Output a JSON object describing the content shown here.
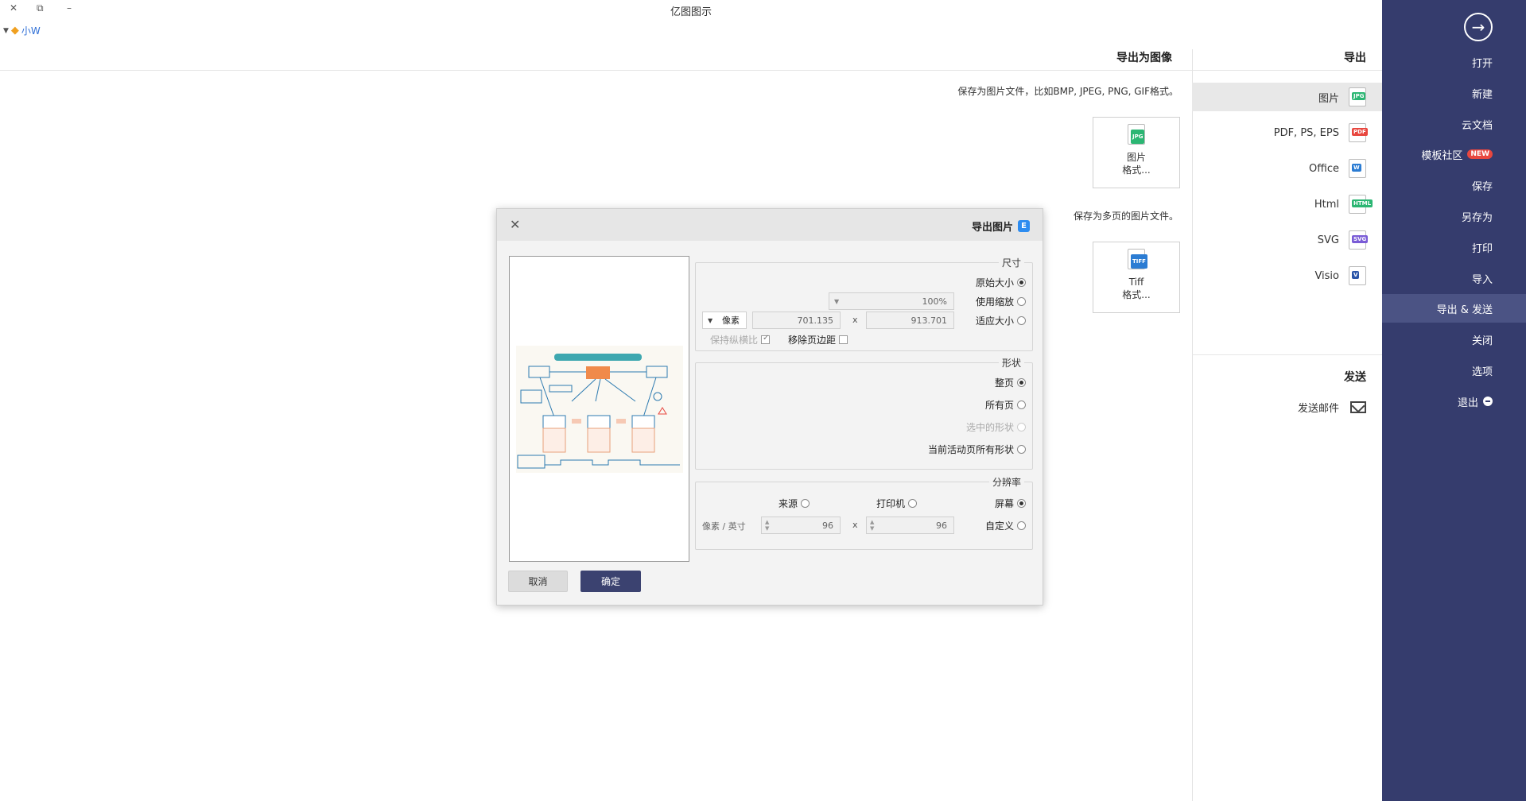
{
  "window": {
    "title": "亿图图示",
    "close_glyph": "✕",
    "restore_glyph": "⧉",
    "minimize_glyph": "–"
  },
  "user": {
    "name": "小W",
    "gem_icon": "gem-icon"
  },
  "nav": {
    "back_glyph": "→",
    "items": [
      {
        "label": "打开"
      },
      {
        "label": "新建"
      },
      {
        "label": "云文档"
      },
      {
        "label": "模板社区",
        "badge": "NEW"
      },
      {
        "label": "保存"
      },
      {
        "label": "另存为"
      },
      {
        "label": "打印"
      },
      {
        "label": "导入"
      },
      {
        "label": "导出 & 发送"
      },
      {
        "label": "关闭"
      },
      {
        "label": "选项"
      },
      {
        "label": "退出"
      }
    ]
  },
  "export": {
    "heading": "导出",
    "formats": [
      {
        "label": "图片",
        "tag": "JPG",
        "color": "#2bb673"
      },
      {
        "label": "PDF, PS, EPS",
        "tag": "PDF",
        "color": "#e8473f"
      },
      {
        "label": "Office",
        "tag": "W",
        "color": "#2b7cd3"
      },
      {
        "label": "Html",
        "tag": "HTML",
        "color": "#2bb673"
      },
      {
        "label": "SVG",
        "tag": "SVG",
        "color": "#7a5cd6"
      },
      {
        "label": "Visio",
        "tag": "V",
        "color": "#2b55a8"
      }
    ],
    "send_heading": "发送",
    "send_mail": "发送邮件"
  },
  "main": {
    "title": "导出为图像",
    "desc1": "保存为图片文件，比如BMP, JPEG, PNG, GIF格式。",
    "card1": {
      "line1": "图片",
      "line2": "格式...",
      "tag": "JPG"
    },
    "desc2": "保存为多页的图片文件。",
    "card2": {
      "line1": "Tiff",
      "line2": "格式...",
      "tag": "TIFF"
    }
  },
  "dialog": {
    "title": "导出图片",
    "logo": "E",
    "close_glyph": "✕",
    "size": {
      "label": "尺寸",
      "original": "原始大小",
      "zoom": "使用缩放",
      "zoom_value": "100%",
      "fit": "适应大小",
      "width": "913.701",
      "height": "701.135",
      "x": "x",
      "unit": "像素",
      "remove_margin": "移除页边距",
      "keep_ratio": "保持纵横比"
    },
    "shape": {
      "label": "形状",
      "whole_page": "整页",
      "all_pages": "所有页",
      "selected": "选中的形状",
      "current_all": "当前活动页所有形状"
    },
    "resolution": {
      "label": "分辨率",
      "screen": "屏幕",
      "printer": "打印机",
      "source": "来源",
      "custom": "自定义",
      "dpi_x": "96",
      "dpi_y": "96",
      "x": "x",
      "unit": "像素 / 英寸"
    },
    "ok": "确定",
    "cancel": "取消"
  }
}
